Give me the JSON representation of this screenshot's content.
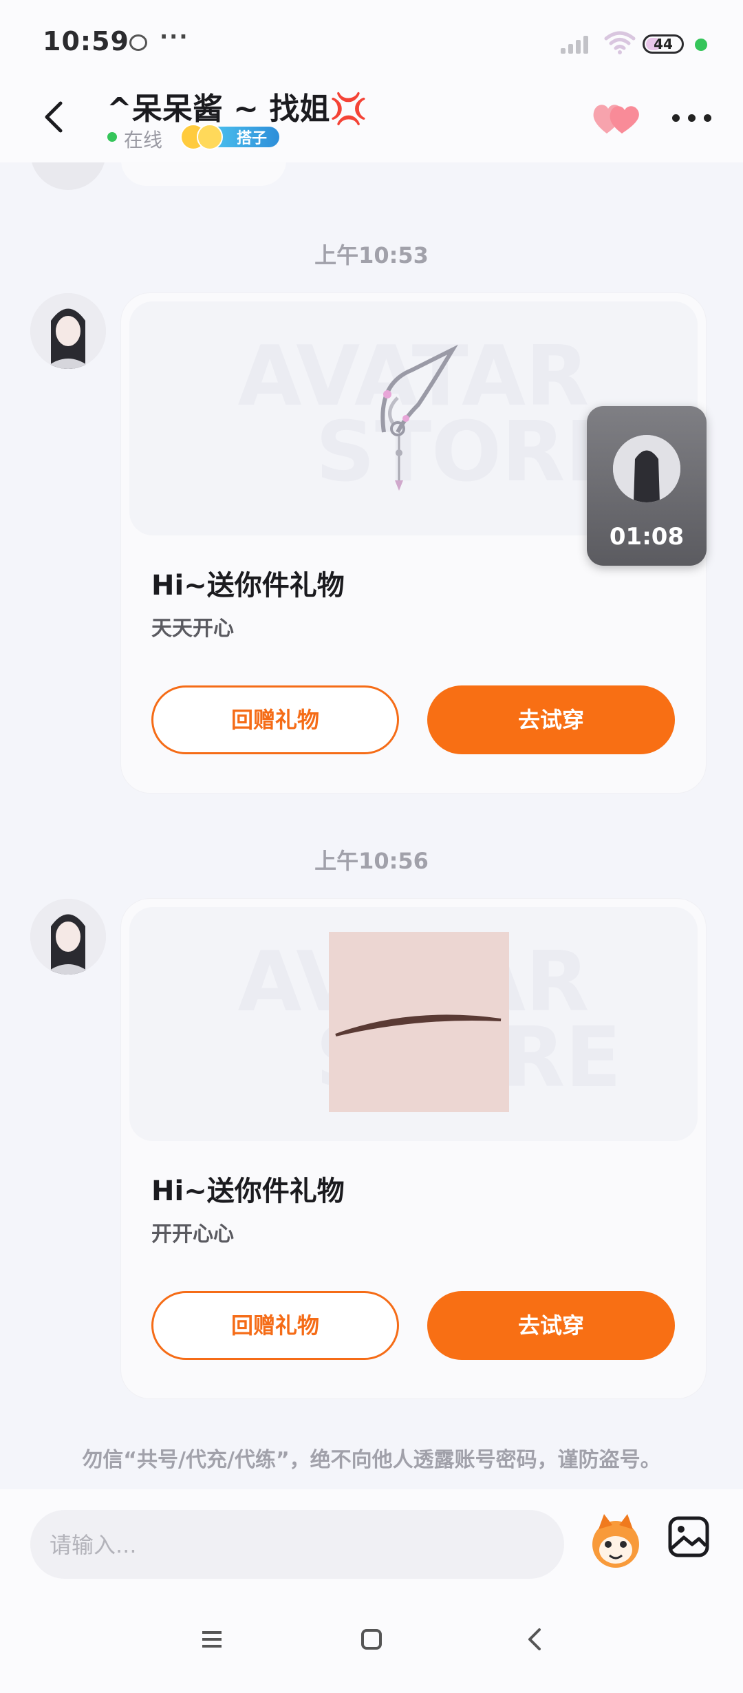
{
  "status_bar": {
    "time": "10:59",
    "more": "···",
    "battery_level": "44",
    "battery_fraction": 0.44
  },
  "header": {
    "title": "^呆呆酱 ~ 找姐💢",
    "online_text": "在线",
    "tag": "搭子"
  },
  "chat": {
    "messages": [
      {
        "timestamp": "上午10:53",
        "title": "Hi~送你件礼物",
        "subtitle": "天天开心",
        "watermark_top": "AVATAR",
        "watermark_bottom": "STORE",
        "return_gift_label": "回赠礼物",
        "try_on_label": "去试穿"
      },
      {
        "timestamp": "上午10:56",
        "title": "Hi~送你件礼物",
        "subtitle": "开开心心",
        "watermark_top": "AVATAR",
        "watermark_bottom": "STORE",
        "return_gift_label": "回赠礼物",
        "try_on_label": "去试穿"
      }
    ],
    "notice": "勿信“共号/代充/代练”，绝不向他人透露账号密码，谨防盗号。"
  },
  "floating_video": {
    "duration": "01:08"
  },
  "input": {
    "placeholder": "请输入..."
  },
  "colors": {
    "accent": "#f86f14",
    "online": "#35c55a",
    "background": "#f4f5fa"
  }
}
